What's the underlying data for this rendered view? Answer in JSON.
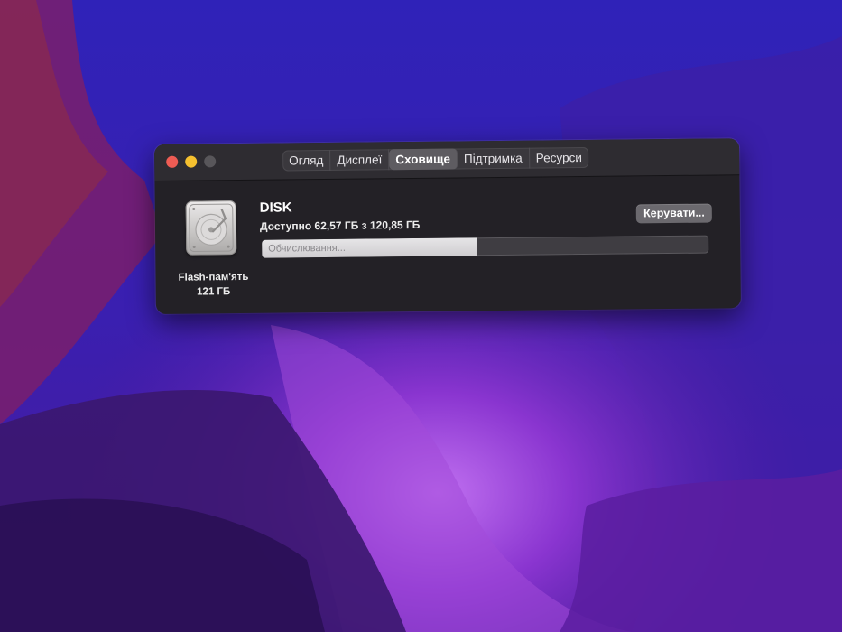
{
  "window": {
    "tabs": [
      {
        "label": "Огляд",
        "active": false
      },
      {
        "label": "Дисплеї",
        "active": false
      },
      {
        "label": "Сховище",
        "active": true
      },
      {
        "label": "Підтримка",
        "active": false
      },
      {
        "label": "Ресурси",
        "active": false
      }
    ]
  },
  "storage": {
    "drive_type": "Flash-пам'ять",
    "drive_capacity": "121 ГБ",
    "volume_name": "DISK",
    "available_text": "Доступно 62,57 ГБ з 120,85 ГБ",
    "manage_label": "Керувати...",
    "status_text": "Обчислювання...",
    "bar_fill_fraction": 0.48
  },
  "colors": {
    "close": "#ee5c54",
    "minimize": "#f5c02f",
    "zoom_inactive": "#58565a",
    "window_bg": "#232126",
    "wallpaper_primary": "#2a1aa8",
    "wallpaper_accent": "#8a2fd0"
  },
  "icons": {
    "drive": "internal-drive-icon"
  }
}
